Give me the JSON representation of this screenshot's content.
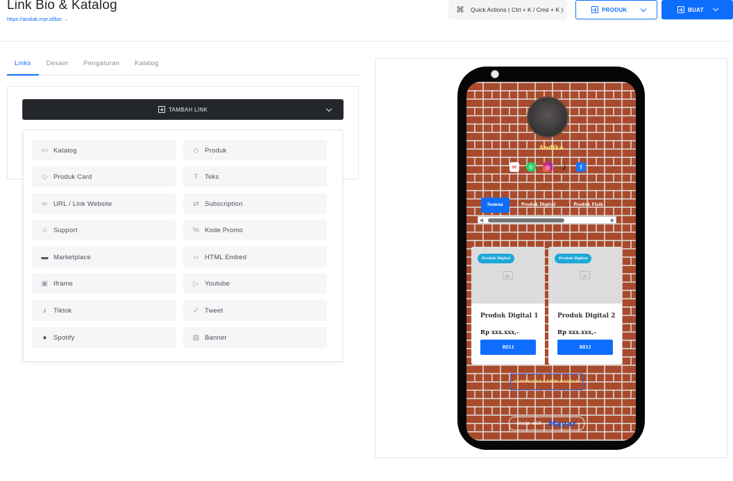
{
  "header": {
    "title": "Link Bio & Katalog",
    "url": "https://andiak.myr.id/bio →",
    "quick_actions_label": "Quick Actions ( Ctrl + K / Cmd + K )",
    "produk_label": "PRODUK",
    "buat_label": "BUAT"
  },
  "tabs": [
    {
      "label": "Links",
      "active": true
    },
    {
      "label": "Desain",
      "active": false
    },
    {
      "label": "Pengaturan",
      "active": false
    },
    {
      "label": "Katalog",
      "active": false
    }
  ],
  "editor": {
    "add_link_label": "TAMBAH LINK",
    "dropdown_items": [
      {
        "label": "Katalog",
        "icon": "folder-icon"
      },
      {
        "label": "Produk",
        "icon": "tag-icon"
      },
      {
        "label": "Produk Card",
        "icon": "tag-icon"
      },
      {
        "label": "Teks",
        "icon": "text-icon"
      },
      {
        "label": "URL / Link Website",
        "icon": "link-icon"
      },
      {
        "label": "Subscription",
        "icon": "repeat-icon"
      },
      {
        "label": "Support",
        "icon": "smile-icon"
      },
      {
        "label": "Kode Promo",
        "icon": "percent-icon"
      },
      {
        "label": "Marketplace",
        "icon": "store-icon"
      },
      {
        "label": "HTML Embed",
        "icon": "code-icon"
      },
      {
        "label": "Iframe",
        "icon": "calendar-icon"
      },
      {
        "label": "Youtube",
        "icon": "youtube-icon"
      },
      {
        "label": "Tiktok",
        "icon": "tiktok-icon"
      },
      {
        "label": "Tweet",
        "icon": "twitter-icon"
      },
      {
        "label": "Spotify",
        "icon": "spotify-icon"
      },
      {
        "label": "Banner",
        "icon": "image-icon"
      }
    ]
  },
  "preview": {
    "profile_name": "Andika",
    "social_icons": [
      "mail-icon",
      "whatsapp-icon",
      "instagram-icon",
      "tiktok-icon",
      "facebook-icon"
    ],
    "category_tabs": [
      {
        "label": "Semua",
        "active": true
      },
      {
        "label": "Produk Digital",
        "active": false
      },
      {
        "label": "Produk Fisik",
        "active": false
      }
    ],
    "products": [
      {
        "badge": "Produk Digital",
        "name": "Produk Digital 1",
        "price": "Rp xxx.xxx,-",
        "button": "BELI"
      },
      {
        "badge": "Produk Digital",
        "name": "Produk Digital 2",
        "price": "Rp xxx.xxx,-",
        "button": "BELI"
      }
    ],
    "show_more_label": "TAMPILKAN LEBIH BANYAK",
    "made_with_label": "Made with",
    "brand_label": "Mayar"
  },
  "colors": {
    "accent": "#0d6efd",
    "dark_button": "#23262b",
    "brick": "#a84a2b",
    "profile_name": "#ffe56b"
  }
}
